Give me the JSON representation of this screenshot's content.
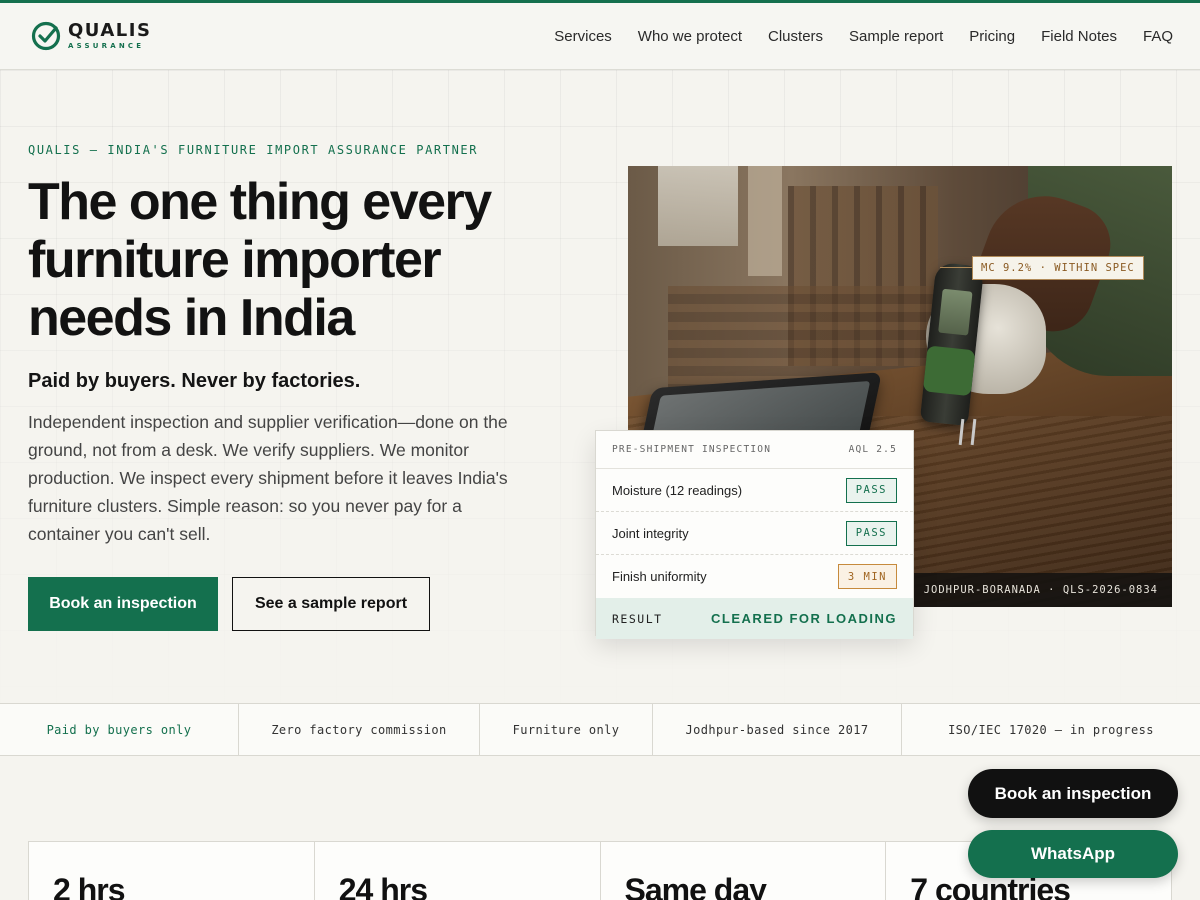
{
  "colors": {
    "brand_green": "#14704e",
    "dark": "#111111",
    "background": "#f5f4ef",
    "warn": "#c68a3c"
  },
  "header": {
    "logo": {
      "name": "QUALIS",
      "sub": "ASSURANCE",
      "icon": "check-circle-icon"
    },
    "nav": [
      "Services",
      "Who we protect",
      "Clusters",
      "Sample report",
      "Pricing",
      "Field Notes",
      "FAQ"
    ]
  },
  "hero": {
    "eyebrow": "QUALIS — INDIA'S FURNITURE IMPORT ASSURANCE PARTNER",
    "title": "The one thing every furniture importer needs in India",
    "subtitle": "Paid by buyers. Never by factories.",
    "body": "Independent inspection and supplier verification—done on the ground, not from a desk. We verify suppliers. We monitor production. We inspect every shipment before it leaves India's furniture clusters. Simple reason: so you never pay for a container you can't sell.",
    "primary_cta": "Book an inspection",
    "secondary_cta": "See a sample report"
  },
  "photo": {
    "tag": "MC 9.2% · WITHIN SPEC",
    "caption": "I · JODHPUR-BORANADA · QLS-2026-0834"
  },
  "inspection_card": {
    "title": "PRE-SHIPMENT INSPECTION",
    "aql": "AQL 2.5",
    "rows": [
      {
        "label": "Moisture (12 readings)",
        "status": "PASS",
        "type": "pass"
      },
      {
        "label": "Joint integrity",
        "status": "PASS",
        "type": "pass"
      },
      {
        "label": "Finish uniformity",
        "status": "3 MIN",
        "type": "warn"
      }
    ],
    "result_label": "RESULT",
    "result_value": "CLEARED FOR LOADING"
  },
  "trust_strip": [
    "Paid by buyers only",
    "Zero factory commission",
    "Furniture only",
    "Jodhpur-based since 2017",
    "ISO/IEC 17020 — in progress"
  ],
  "stats": [
    "2 hrs",
    "24 hrs",
    "Same day",
    "7 countries"
  ],
  "floating": {
    "book": "Book an inspection",
    "whatsapp": "WhatsApp"
  }
}
